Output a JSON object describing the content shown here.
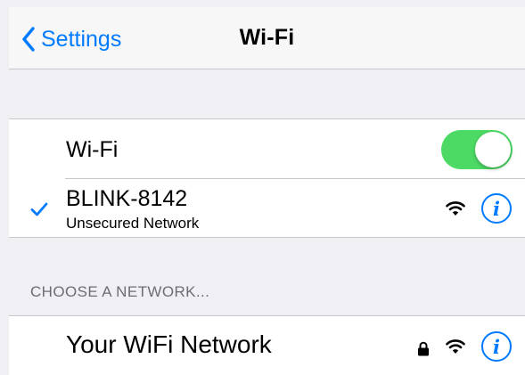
{
  "navbar": {
    "back_label": "Settings",
    "title": "Wi-Fi"
  },
  "wifi_toggle": {
    "label": "Wi-Fi",
    "state": "on",
    "color": "#4cd964"
  },
  "connected_network": {
    "name": "BLINK-8142",
    "subtitle": "Unsecured Network",
    "selected": true,
    "icons": [
      "checkmark-icon",
      "wifi-signal-icon",
      "info-icon"
    ]
  },
  "choose_section": {
    "header": "CHOOSE A NETWORK..."
  },
  "networks": [
    {
      "name": "Your WiFi Network",
      "secured": true,
      "icons": [
        "lock-icon",
        "wifi-signal-icon",
        "info-icon"
      ]
    }
  ],
  "colors": {
    "accent": "#007aff",
    "background": "#efeff4",
    "separator": "#c8c7cc"
  }
}
